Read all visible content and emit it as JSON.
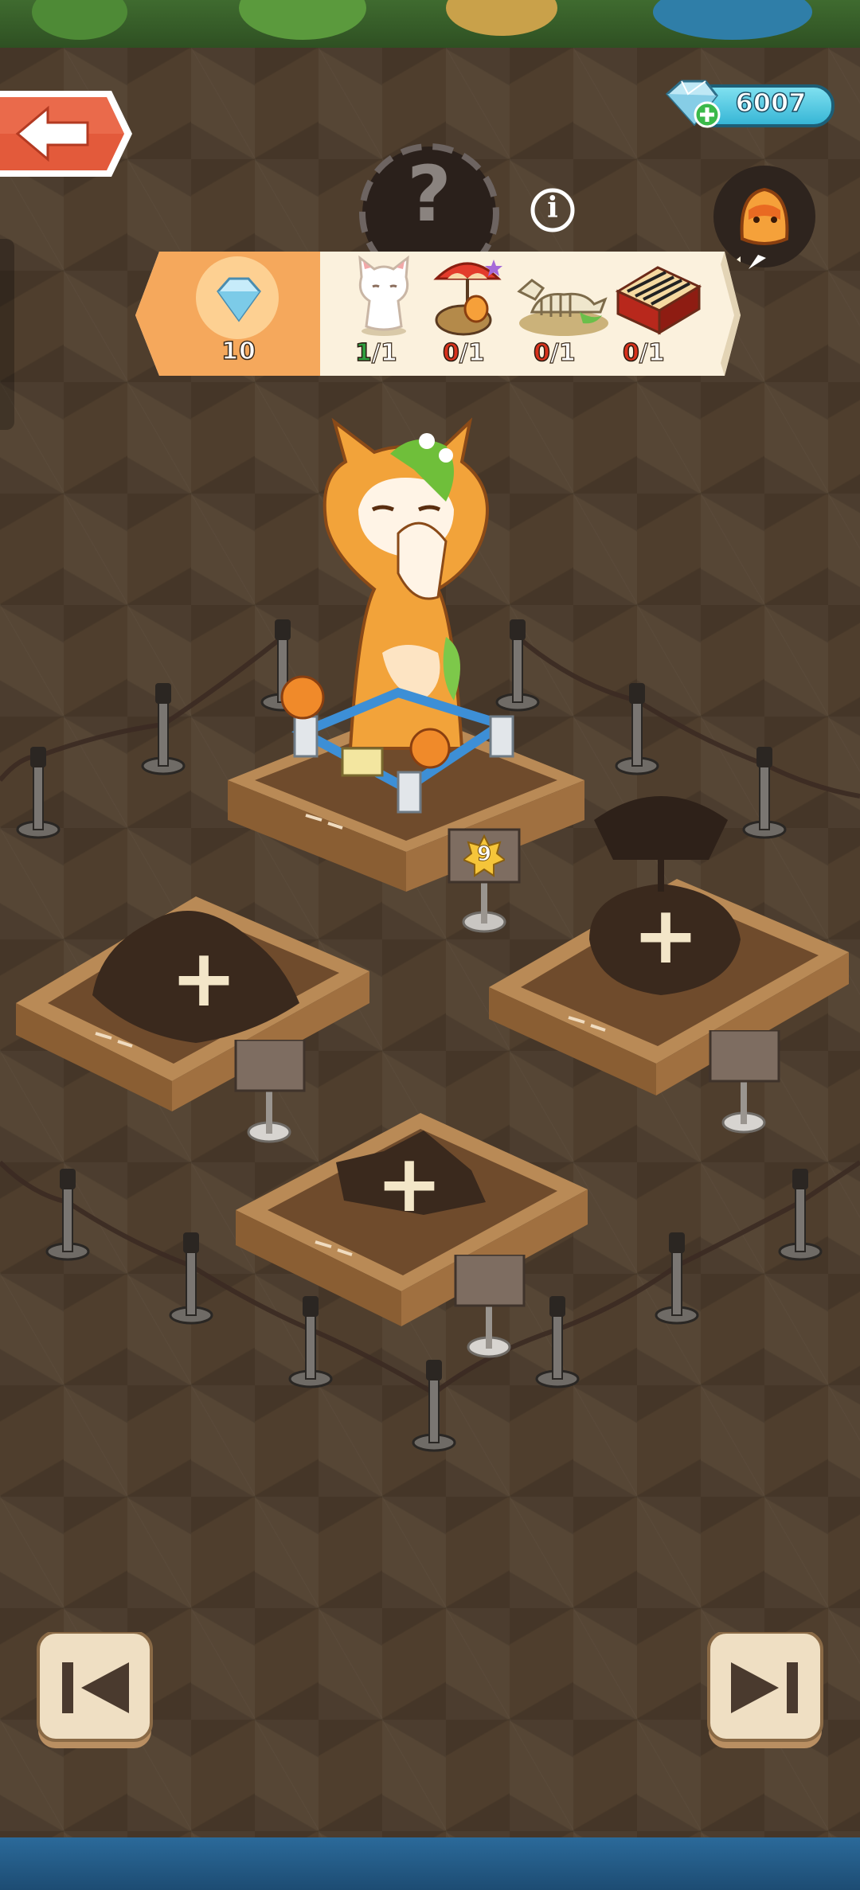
{
  "header": {
    "gems": "6007",
    "mystery_symbol": "?",
    "info_symbol": "i"
  },
  "collection": {
    "reward_amount": "10",
    "items": [
      {
        "name": "white-cat-figure",
        "collected": "1",
        "total": "/1",
        "complete": true
      },
      {
        "name": "umbrella-chick-figure",
        "collected": "0",
        "total": "/1",
        "complete": false
      },
      {
        "name": "fossil-skeleton",
        "collected": "0",
        "total": "/1",
        "complete": false
      },
      {
        "name": "red-piano",
        "collected": "0",
        "total": "/1",
        "complete": false
      }
    ]
  },
  "exhibits": {
    "main_plaque_level": "9",
    "empty_slot_symbol": "+"
  },
  "colors": {
    "complete_count": "#2f9e3f",
    "incomplete_count": "#d8321c",
    "accent_gem": "#37b6d6",
    "back_button": "#e25a3a"
  }
}
